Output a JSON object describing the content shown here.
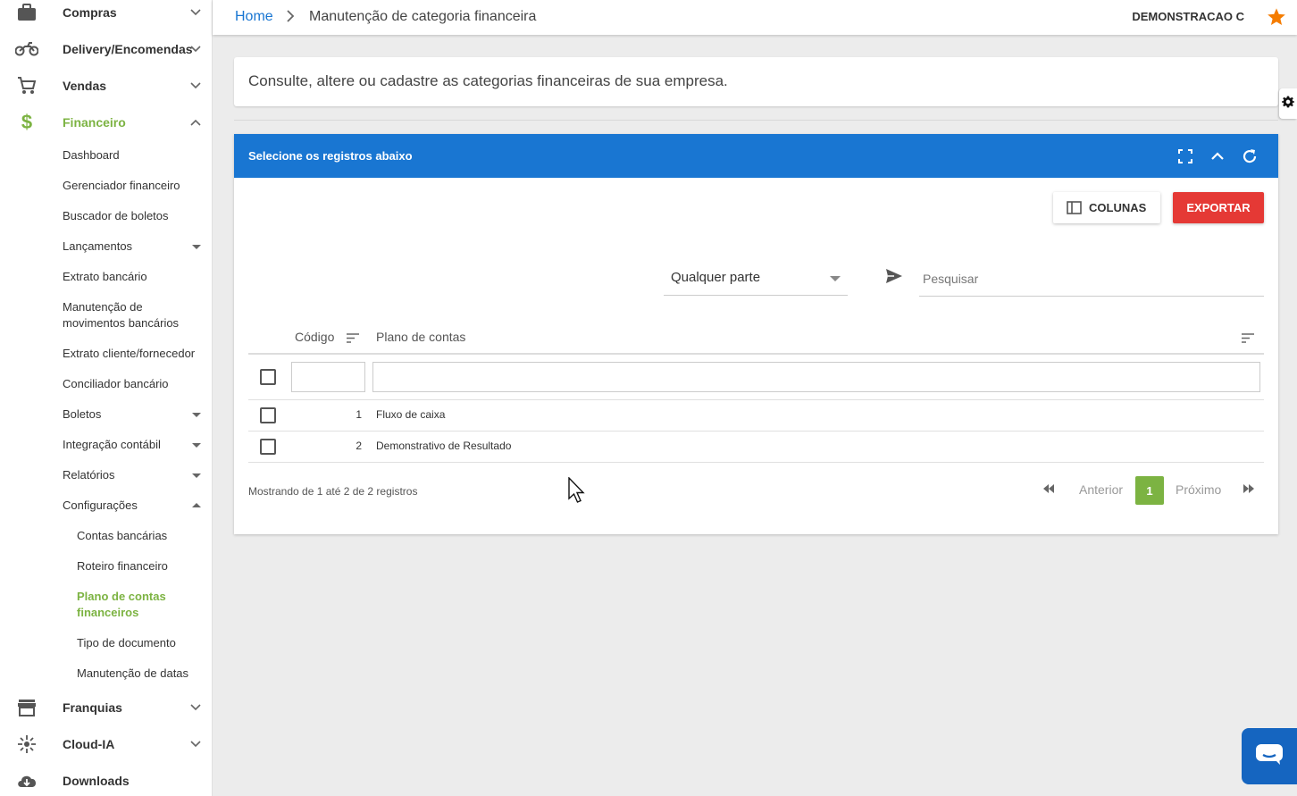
{
  "sidebar": {
    "compras": "Compras",
    "delivery": "Delivery/Encomendas",
    "vendas": "Vendas",
    "financeiro": "Financeiro",
    "dashboard": "Dashboard",
    "gerenciador": "Gerenciador financeiro",
    "buscador": "Buscador de boletos",
    "lancamentos": "Lançamentos",
    "extrato": "Extrato bancário",
    "manutencao_mov_1": "Manutenção de",
    "manutencao_mov_2": "movimentos bancários",
    "extrato_cli": "Extrato cliente/fornecedor",
    "conciliador": "Conciliador bancário",
    "boletos": "Boletos",
    "integracao": "Integração contábil",
    "relatorios": "Relatórios",
    "configuracoes": "Configurações",
    "contas": "Contas bancárias",
    "roteiro": "Roteiro financeiro",
    "plano_1": "Plano de contas",
    "plano_2": "financeiros",
    "tipo_doc": "Tipo de documento",
    "manut_datas": "Manutenção de datas",
    "franquias": "Franquias",
    "cloud": "Cloud-IA",
    "downloads": "Downloads"
  },
  "header": {
    "home": "Home",
    "current": "Manutenção de categoria financeira",
    "company": "DEMONSTRACAO C"
  },
  "intro_text": "Consulte, altere ou cadastre as categorias financeiras de sua empresa.",
  "panel": {
    "title": "Selecione os registros abaixo",
    "columns_button": "COLUNAS",
    "export_button": "EXPORTAR",
    "search_mode": "Qualquer parte",
    "search_placeholder": "Pesquisar",
    "col_codigo": "Código",
    "col_plano": "Plano de contas",
    "rows": [
      {
        "codigo": "1",
        "plano": "Fluxo de caixa"
      },
      {
        "codigo": "2",
        "plano": "Demonstrativo de Resultado"
      }
    ],
    "info": "Mostrando de 1 até 2 de 2 registros",
    "prev": "Anterior",
    "page": "1",
    "next": "Próximo"
  },
  "colors": {
    "accent_green": "#7cb342",
    "header_blue": "#1976d2",
    "export_red": "#e53935",
    "star_orange": "#f57c00"
  }
}
